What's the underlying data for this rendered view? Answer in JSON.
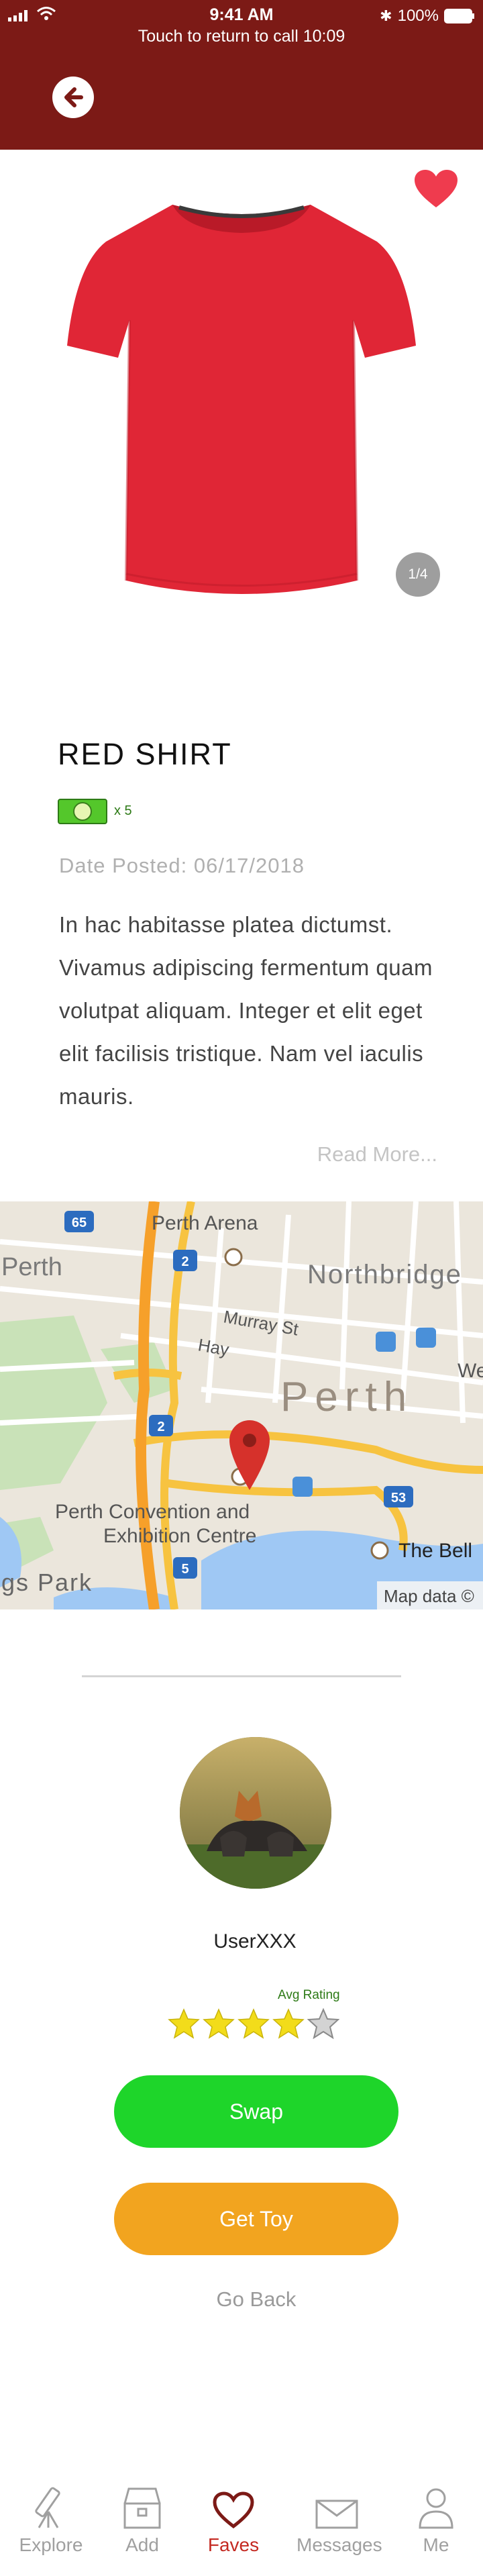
{
  "status_bar": {
    "time": "9:41 AM",
    "battery": "100%",
    "call_banner": "Touch to return to call 10:09"
  },
  "colors": {
    "header": "#7c1a16",
    "swap": "#1ed52a",
    "get_toy": "#f2a41f",
    "active_tab": "#c42a22"
  },
  "product": {
    "page_indicator": "1/4",
    "title": "RED SHIRT",
    "coin_count": "x 5",
    "date_posted": "Date Posted: 06/17/2018",
    "description": "In hac habitasse platea dictumst. Vivamus adipiscing fermentum quam volutpat aliquam. Integer et elit eget elit facilisis tristique. Nam vel iaculis mauris.",
    "read_more": "Read More..."
  },
  "map": {
    "labels": [
      "Perth Arena",
      "Perth",
      "Northbridge",
      "Murray St",
      "Hay",
      "Perth",
      "We",
      "Perth Convention and",
      "Exhibition Centre",
      "The Bell",
      "gs Park",
      "Map data ©"
    ],
    "shields": [
      "65",
      "2",
      "2",
      "53",
      "5"
    ]
  },
  "seller": {
    "username": "UserXXX",
    "avg_rating_label": "Avg Rating",
    "rating": 4,
    "rating_max": 5
  },
  "actions": {
    "swap": "Swap",
    "get_toy": "Get Toy",
    "go_back": "Go Back"
  },
  "tabs": [
    {
      "label": "Explore",
      "icon": "telescope-icon"
    },
    {
      "label": "Add",
      "icon": "toy-box-icon"
    },
    {
      "label": "Faves",
      "icon": "heart-icon",
      "active": true
    },
    {
      "label": "Messages",
      "icon": "envelope-icon"
    },
    {
      "label": "Me",
      "icon": "user-icon"
    }
  ]
}
